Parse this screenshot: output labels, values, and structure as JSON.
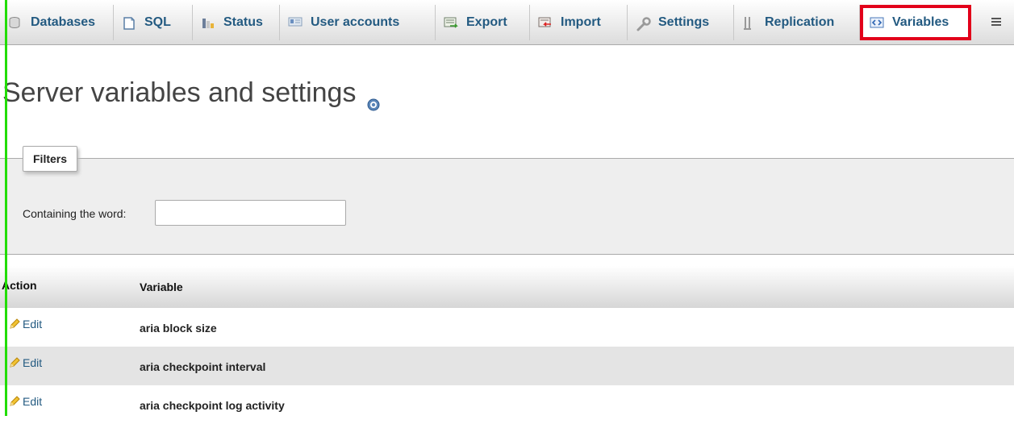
{
  "nav": {
    "tabs": [
      {
        "label": "Databases",
        "icon": "database-icon"
      },
      {
        "label": "SQL",
        "icon": "sql-icon"
      },
      {
        "label": "Status",
        "icon": "status-icon"
      },
      {
        "label": "User accounts",
        "icon": "user-accounts-icon"
      },
      {
        "label": "Export",
        "icon": "export-icon"
      },
      {
        "label": "Import",
        "icon": "import-icon"
      },
      {
        "label": "Settings",
        "icon": "wrench-icon"
      },
      {
        "label": "Replication",
        "icon": "replication-icon"
      },
      {
        "label": "Variables",
        "icon": "variables-icon",
        "active": true
      },
      {
        "label": "",
        "icon": "more-icon"
      }
    ],
    "highlight_color": "#e2001a"
  },
  "page": {
    "title": "Server variables and settings",
    "help_icon": "help-icon"
  },
  "filters": {
    "legend": "Filters",
    "containing_label": "Containing the word:",
    "containing_value": "",
    "containing_placeholder": ""
  },
  "table": {
    "headers": {
      "action": "Action",
      "variable": "Variable"
    },
    "rows": [
      {
        "action": "Edit",
        "variable": "aria block size"
      },
      {
        "action": "Edit",
        "variable": "aria checkpoint interval"
      },
      {
        "action": "Edit",
        "variable": "aria checkpoint log activity"
      }
    ]
  },
  "colors": {
    "link": "#235a81",
    "active_tab_border": "#e2001a",
    "side_marker": "#22dd00"
  }
}
